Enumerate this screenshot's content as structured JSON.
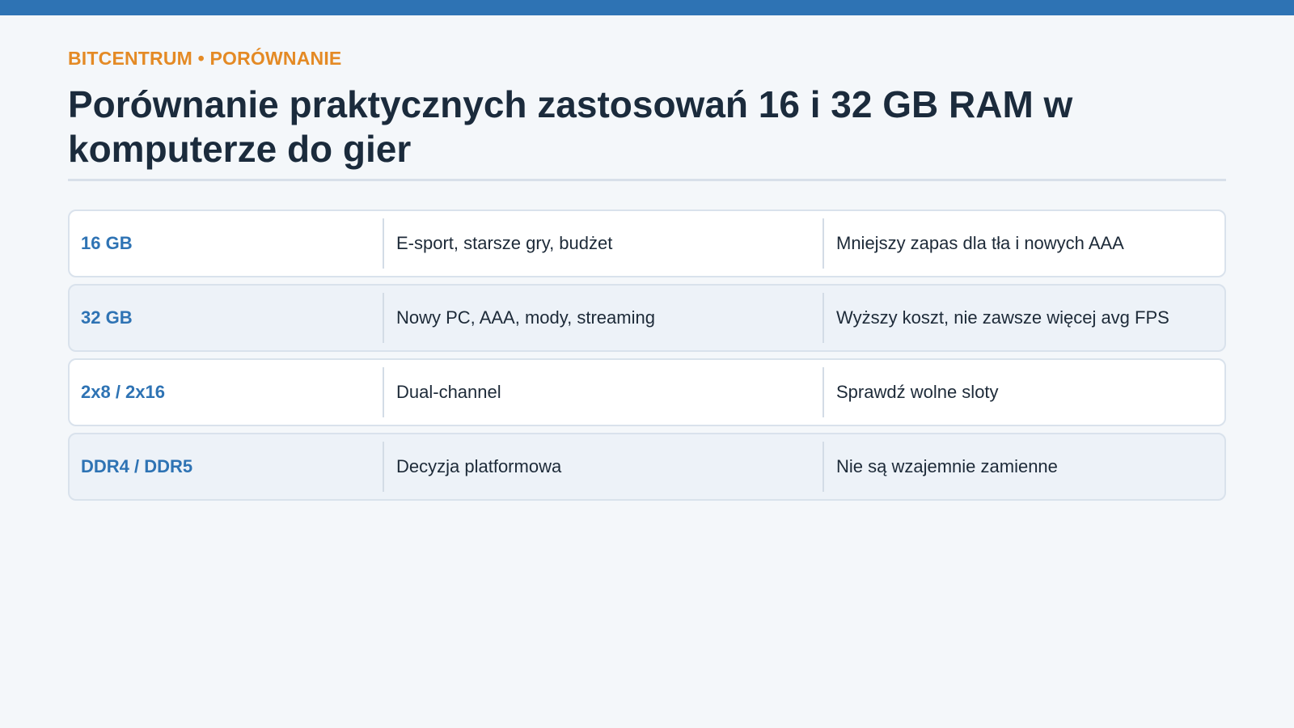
{
  "colors": {
    "top_bar": "#2e73b4",
    "eyebrow": "#e48a25",
    "label": "#2e73b4"
  },
  "eyebrow": "BITCENTRUM • PORÓWNANIE",
  "title": "Porównanie praktycznych zastosowań 16 i 32 GB RAM w komputerze do gier",
  "rows": [
    {
      "label": "16 GB",
      "use": "E-sport, starsze gry, budżet",
      "note": "Mniejszy zapas dla tła i nowych AAA"
    },
    {
      "label": "32 GB",
      "use": "Nowy PC, AAA, mody, streaming",
      "note": "Wyższy koszt, nie zawsze więcej avg FPS"
    },
    {
      "label": "2x8 / 2x16",
      "use": "Dual-channel",
      "note": "Sprawdź wolne sloty"
    },
    {
      "label": "DDR4 / DDR5",
      "use": "Decyzja platformowa",
      "note": "Nie są wzajemnie zamienne"
    }
  ]
}
